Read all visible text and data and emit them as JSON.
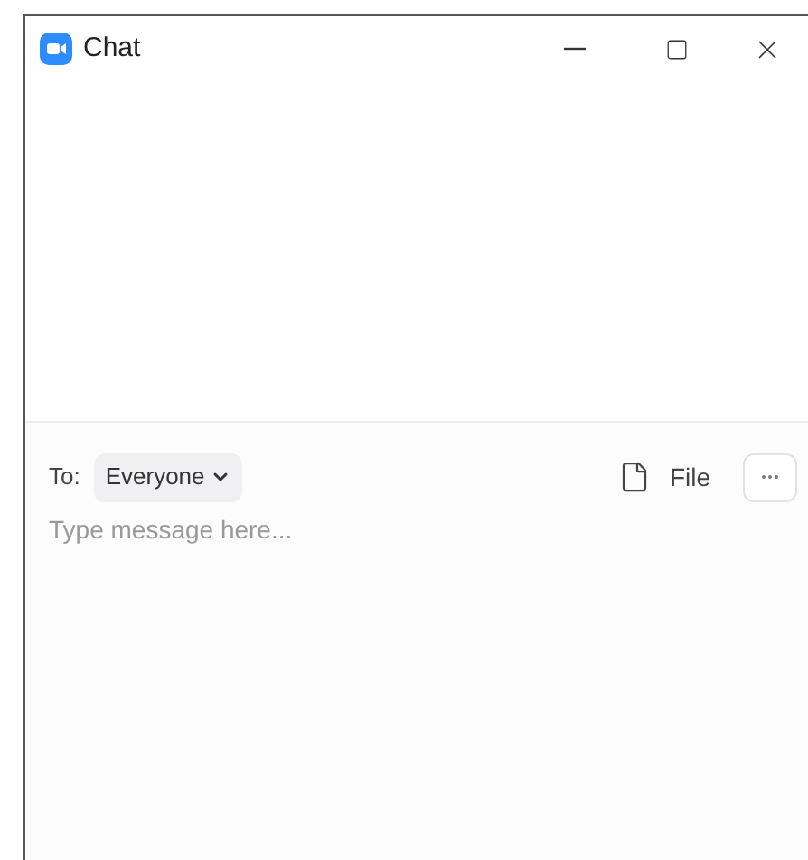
{
  "window": {
    "title": "Chat"
  },
  "compose": {
    "to_label": "To:",
    "recipient": "Everyone",
    "file_button": "File",
    "placeholder": "Type message here..."
  }
}
